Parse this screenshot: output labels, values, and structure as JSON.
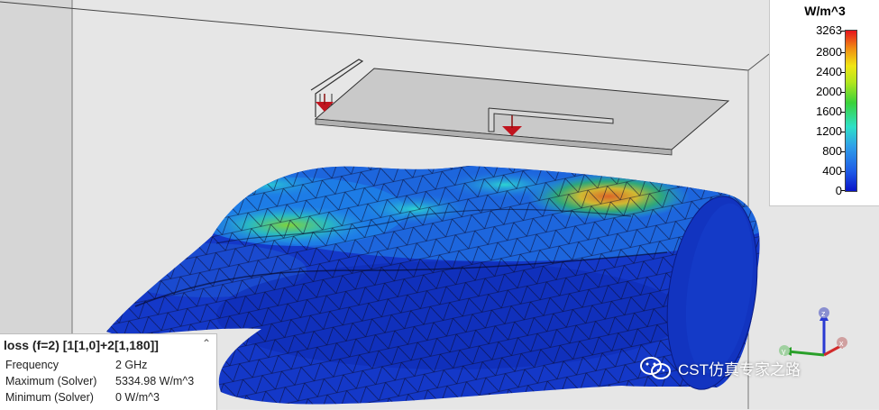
{
  "legend": {
    "unit": "W/m^3",
    "ticks": [
      "3263",
      "2800",
      "2400",
      "2000",
      "1600",
      "1200",
      "800",
      "400",
      "0"
    ],
    "max": 3263,
    "min": 0,
    "colors": [
      "#0a14c8",
      "#2fa0e8",
      "#2ee0c8",
      "#3ad23a",
      "#f0e614",
      "#f08c14",
      "#e6141e"
    ]
  },
  "info": {
    "title": "loss (f=2) [1[1,0]+2[1,180]]",
    "rows": [
      {
        "label": "Frequency",
        "value": "2 GHz"
      },
      {
        "label": "Maximum (Solver)",
        "value": "5334.98 W/m^3"
      },
      {
        "label": "Minimum (Solver)",
        "value": "0 W/m^3"
      }
    ]
  },
  "axes": {
    "x": "x",
    "y": "y",
    "z": "z"
  },
  "watermark": "CST仿真专家之路",
  "icons": [
    "chevron-up-icon",
    "wechat-icon"
  ]
}
